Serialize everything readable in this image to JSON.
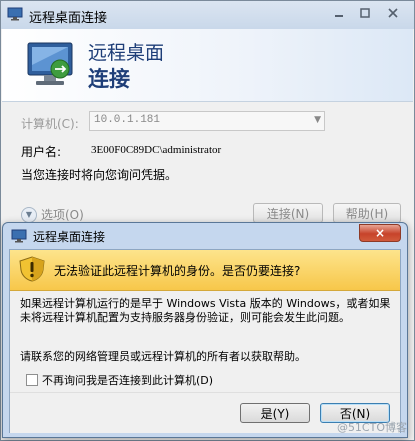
{
  "background_window": {
    "title": "远程桌面连接",
    "banner_line1": "远程桌面",
    "banner_line2": "连接",
    "computer_label": "计算机(C):",
    "computer_value": "10.0.1.181",
    "user_label": "用户名:",
    "user_value": "3E00F0C89DC\\administrator",
    "credentials_note": "当您连接时将向您询问凭据。",
    "options_label": "选项(O)",
    "connect_button": "连接(N)",
    "help_button": "帮助(H)"
  },
  "dialog": {
    "title": "远程桌面连接",
    "warning_text": "无法验证此远程计算机的身份。是否仍要连接?",
    "body_text": "如果远程计算机运行的是早于 Windows Vista 版本的 Windows，或者如果未将远程计算机配置为支持服务器身份验证，则可能会发生此问题。",
    "contact_text": "请联系您的网络管理员或远程计算机的所有者以获取帮助。",
    "checkbox_label": "不再询问我是否连接到此计算机(D)",
    "checkbox_checked": false,
    "yes_button": "是(Y)",
    "no_button": "否(N)",
    "close_glyph": "×"
  },
  "watermark": "@51CTO博客"
}
